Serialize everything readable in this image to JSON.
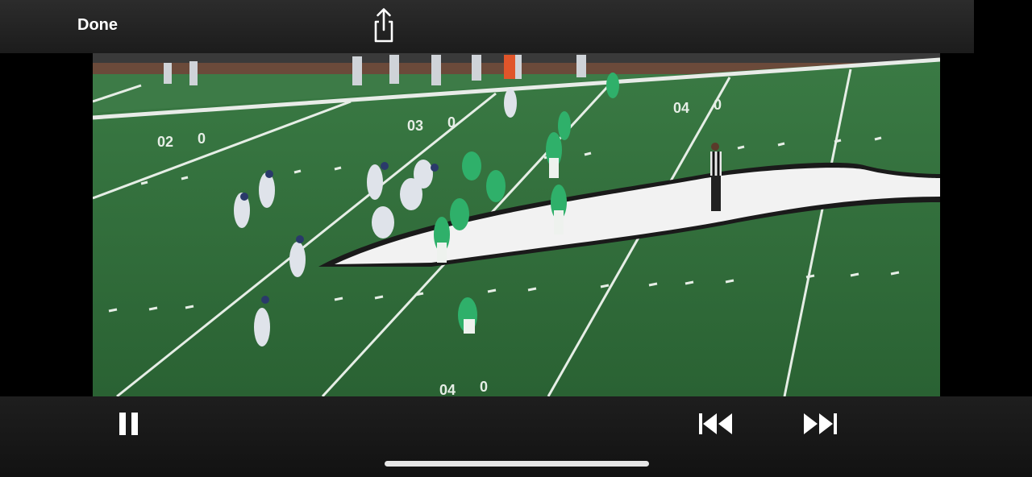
{
  "top_bar": {
    "done_label": "Done",
    "share_icon": "share-icon"
  },
  "video": {
    "content": "football-game-footage",
    "playing": true
  },
  "controls": {
    "pause_icon": "pause-icon",
    "rewind_icon": "skip-back-icon",
    "forward_icon": "skip-forward-icon"
  },
  "colors": {
    "field_green": "#2f6b3a",
    "bar_background": "#1c1c1c",
    "icon_white": "#ffffff"
  }
}
